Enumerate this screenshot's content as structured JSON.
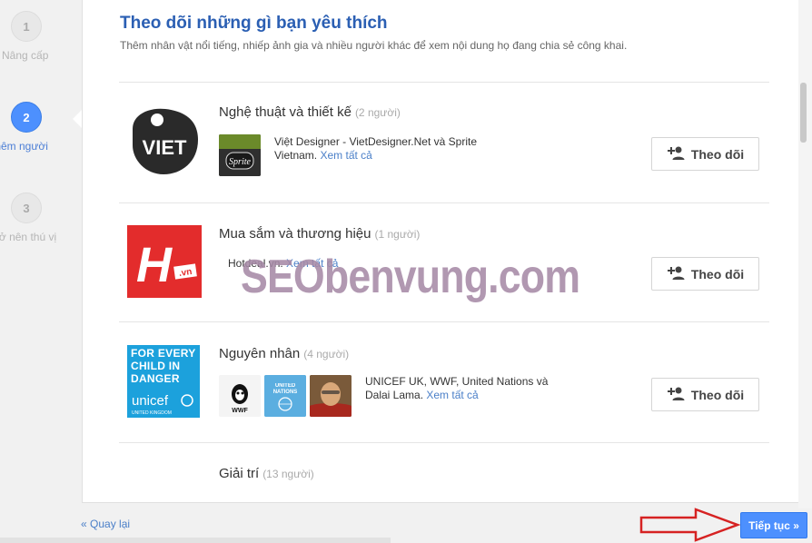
{
  "steps": [
    {
      "number": "1",
      "label": "Nâng cấp"
    },
    {
      "number": "2",
      "label": "Thêm người"
    },
    {
      "number": "3",
      "label": "Trở nên thú vị"
    }
  ],
  "header": {
    "title": "Theo dõi những gì bạn yêu thích",
    "subtitle": "Thêm nhân vật nổi tiếng, nhiếp ảnh gia và nhiều người khác để xem nội dung họ đang chia sẻ công khai."
  },
  "categories": [
    {
      "title": "Nghệ thuật và thiết kế",
      "count": "(2 người)",
      "logo_text": "VIET",
      "thumbs": [
        "Sprite"
      ],
      "members": "Việt Designer - VietDesigner.Net và Sprite Vietnam.",
      "see_all": "Xem tất cả",
      "follow_label": "Theo dõi"
    },
    {
      "title": "Mua sắm và thương hiệu",
      "count": "(1 người)",
      "logo_text": "H",
      "logo_sub": ".vn",
      "members": "Hotdeal.vn.",
      "see_all": "Xem tất cả",
      "follow_label": "Theo dõi"
    },
    {
      "title": "Nguyên nhân",
      "count": "(4 người)",
      "logo_text": "FOR EVERY CHILD IN DANGER",
      "logo_brand": "unicef",
      "logo_sub": "UNITED KINGDOM",
      "thumbs": [
        "WWF",
        "UNITED NATIONS",
        ""
      ],
      "members": "UNICEF UK, WWF, United Nations và Dalai Lama.",
      "see_all": "Xem tất cả",
      "follow_label": "Theo dõi"
    },
    {
      "title": "Giải trí",
      "count": "(13 người)"
    }
  ],
  "footer": {
    "back_label": "« Quay lại",
    "next_label": "Tiếp tục »"
  },
  "watermark": "SEObenvung.com",
  "colors": {
    "accent": "#4d90fe",
    "title": "#2b5fb3",
    "link": "#4a7fc8",
    "unicef": "#1ca1dc",
    "brand_red": "#e32c2c",
    "arrow": "#d62222"
  }
}
